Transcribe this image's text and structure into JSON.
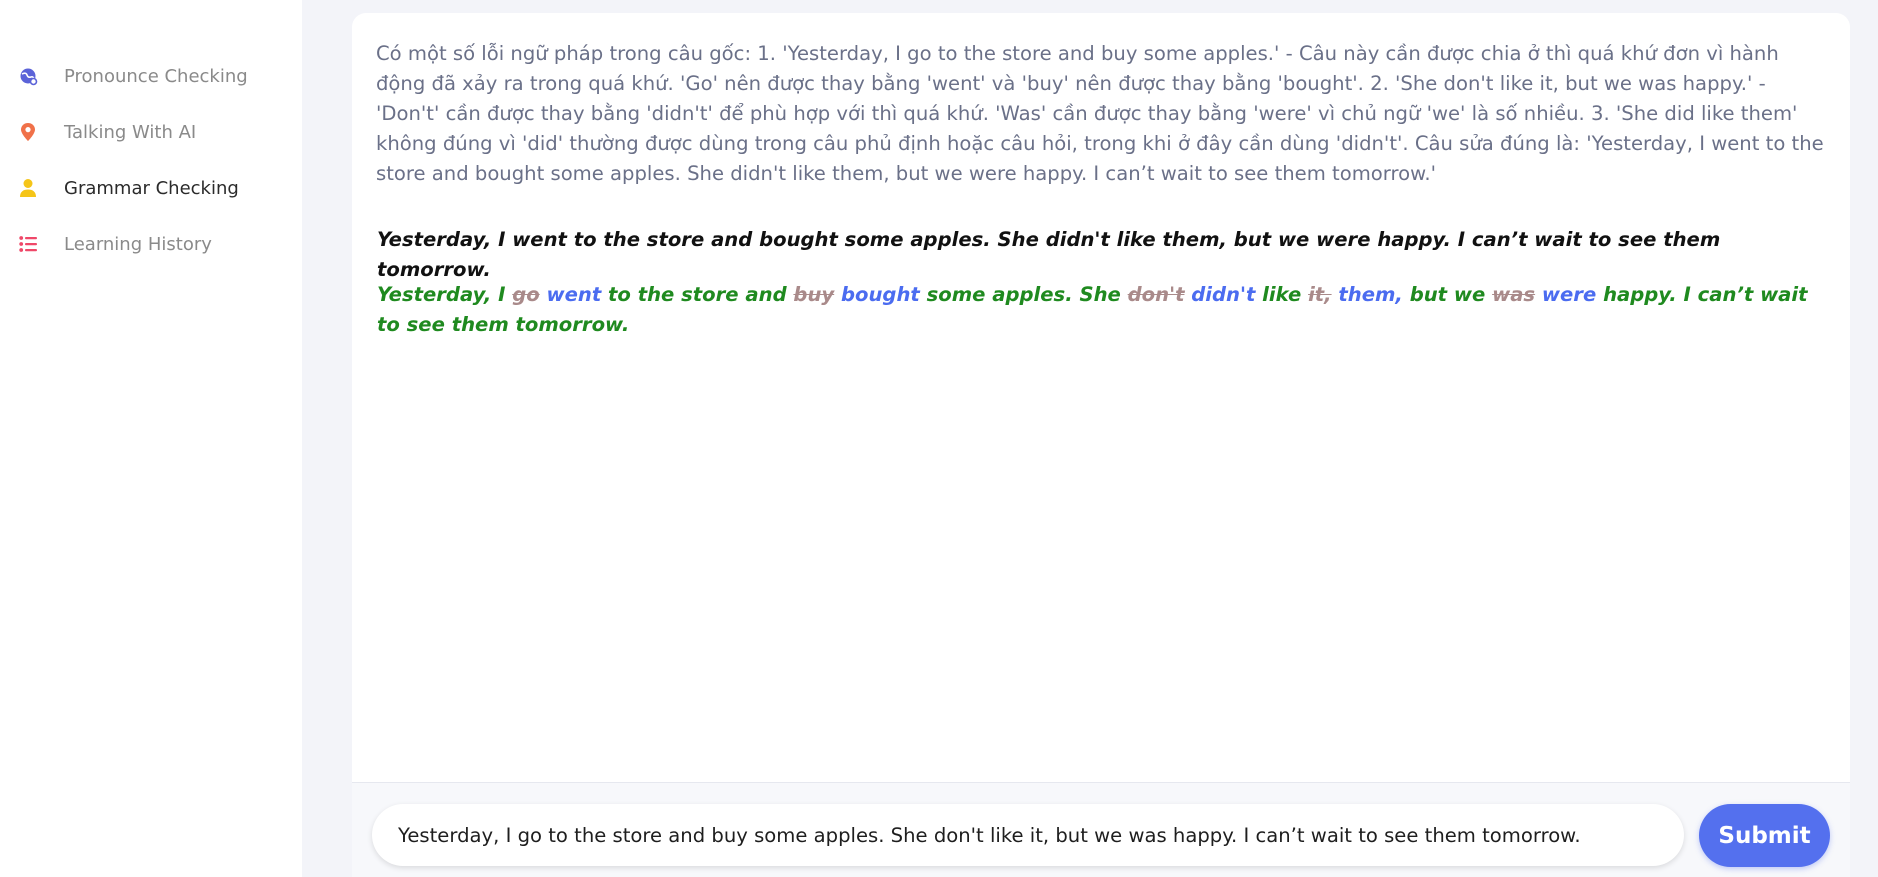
{
  "sidebar": {
    "items": [
      {
        "label": "Pronounce Checking",
        "icon": "globe-icon",
        "icon_color": "#5b63d8"
      },
      {
        "label": "Talking With AI",
        "icon": "map-pin-icon",
        "icon_color": "#f07149"
      },
      {
        "label": "Grammar Checking",
        "icon": "user-icon",
        "icon_color": "#f5c518",
        "active": true
      },
      {
        "label": "Learning History",
        "icon": "list-icon",
        "icon_color": "#ef4869"
      }
    ]
  },
  "result": {
    "explanation": "Có một số lỗi ngữ pháp trong câu gốc: 1. 'Yesterday, I go to the store and buy some apples.' - Câu này cần được chia ở thì quá khứ đơn vì hành động đã xảy ra trong quá khứ. 'Go' nên được thay bằng 'went' và 'buy' nên được thay bằng 'bought'. 2. 'She don't like it, but we was happy.' - 'Don't' cần được thay bằng 'didn't' để phù hợp với thì quá khứ. 'Was' cần được thay bằng 'were' vì chủ ngữ 'we' là số nhiều. 3. 'She did like them' không đúng vì 'did' thường được dùng trong câu phủ định hoặc câu hỏi, trong khi ở đây cần dùng 'didn't'. Câu sửa đúng là: 'Yesterday, I went to the store and bought some apples. She didn't like them, but we were happy. I can’t wait to see them tomorrow.'",
    "corrected": "Yesterday, I went to the store and bought some apples. She didn't like them, but we were happy. I can’t wait to see them tomorrow.",
    "diff": {
      "s1": "Yesterday, I ",
      "d1": "go",
      "i1": " went",
      "s2": " to the store and ",
      "d2": "buy",
      "i2": " bought",
      "s3": " some apples. She ",
      "d3": "don't",
      "i3": " didn't",
      "s4": " like ",
      "d4": "it,",
      "i4": " them,",
      "s5": " but we ",
      "d5": "was",
      "i5": " were",
      "s6": " happy. I can’t wait to see them tomorrow."
    },
    "colors": {
      "unchanged": "#1f8a1f",
      "deleted": "#a98a8a",
      "inserted": "#4b6cf0"
    }
  },
  "input": {
    "value": "Yesterday, I go to the store and buy some apples. She don't like it, but we was happy. I can’t wait to see them tomorrow.",
    "submit_label": "Submit",
    "accent": "#5470ee"
  }
}
